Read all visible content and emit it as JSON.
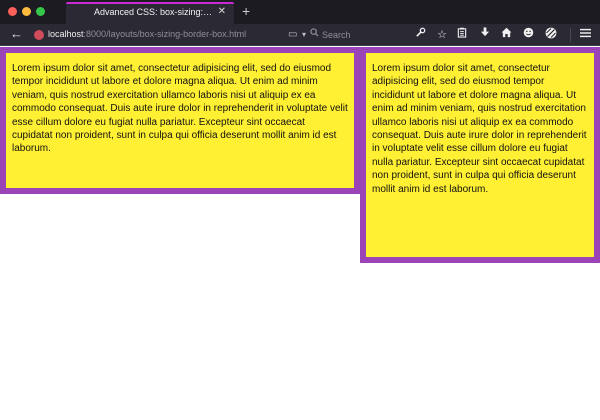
{
  "browser": {
    "tab": {
      "title": "Advanced CSS: box-sizing: bor…"
    },
    "new_tab_label": "+",
    "back_label": "←",
    "url": {
      "host": "localhost",
      "port": ":8000",
      "path": "/layouts/box-sizing-border-box.html"
    },
    "search": {
      "placeholder": "Search"
    },
    "accent_color": "#c92ad3"
  },
  "page": {
    "box_left": {
      "text": "Lorem ipsum dolor sit amet, consectetur adipisicing elit, sed do eiusmod tempor incididunt ut labore et dolore magna aliqua. Ut enim ad minim veniam, quis nostrud exercitation ullamco laboris nisi ut aliquip ex ea commodo consequat. Duis aute irure dolor in reprehenderit in voluptate velit esse cillum dolore eu fugiat nulla pariatur. Excepteur sint occaecat cupidatat non proident, sunt in culpa qui officia deserunt mollit anim id est laborum."
    },
    "box_right": {
      "text": "Lorem ipsum dolor sit amet, consectetur adipisicing elit, sed do eiusmod tempor incididunt ut labore et dolore magna aliqua. Ut enim ad minim veniam, quis nostrud exercitation ullamco laboris nisi ut aliquip ex ea commodo consequat. Duis aute irure dolor in reprehenderit in voluptate velit esse cillum dolore eu fugiat nulla pariatur. Excepteur sint occaecat cupidatat non proident, sunt in culpa qui officia deserunt mollit anim id est laborum."
    },
    "colors": {
      "box_fill": "#fff033",
      "box_border": "#9b44b8"
    }
  },
  "toolbar_icons": [
    "wrench-icon",
    "star-icon",
    "clipboard-icon",
    "download-icon",
    "home-icon",
    "emoji-icon",
    "sync-icon",
    "hamburger-menu-icon"
  ]
}
